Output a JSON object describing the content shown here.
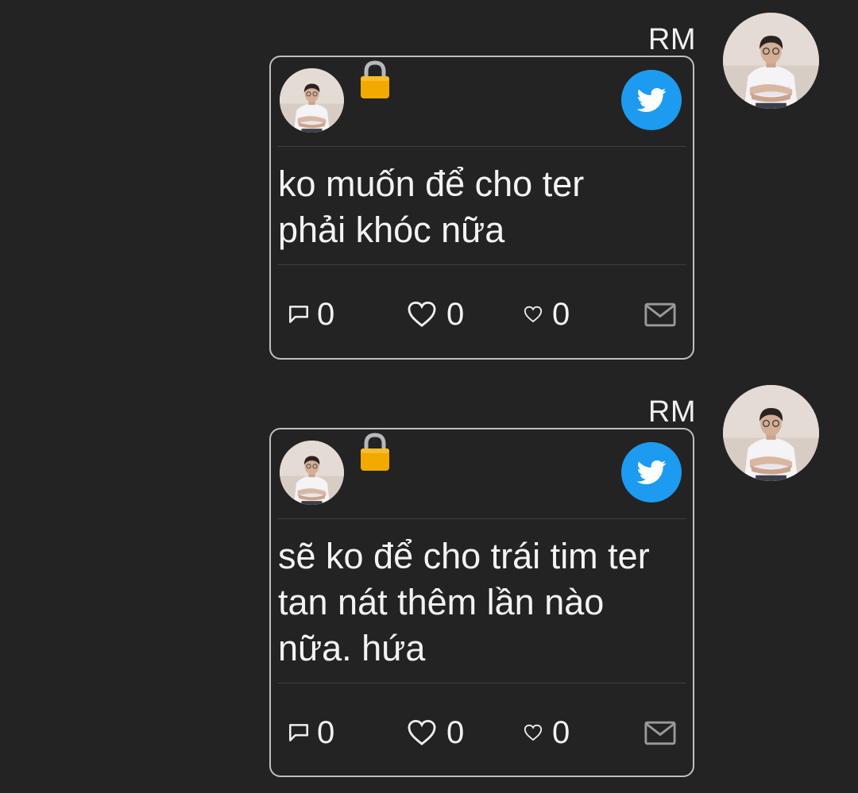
{
  "colors": {
    "background": "#232323",
    "card_border": "#bfbfbf",
    "twitter_blue": "#1d9bf0",
    "lock_gold": "#f2a900"
  },
  "messages": [
    {
      "sender": "RM",
      "avatar_icon": "user-photo",
      "lock_icon": "lock-icon",
      "source_icon": "twitter-bird-icon",
      "text": "ko muốn để cho ter\nphải khóc nữa",
      "stats": {
        "comments": "0",
        "likes": "0",
        "hearts": "0"
      }
    },
    {
      "sender": "RM",
      "avatar_icon": "user-photo",
      "lock_icon": "lock-icon",
      "source_icon": "twitter-bird-icon",
      "text": "sẽ ko để cho trái tim ter\ntan nát thêm lần nào\nnữa. hứa",
      "stats": {
        "comments": "0",
        "likes": "0",
        "hearts": "0"
      }
    }
  ]
}
